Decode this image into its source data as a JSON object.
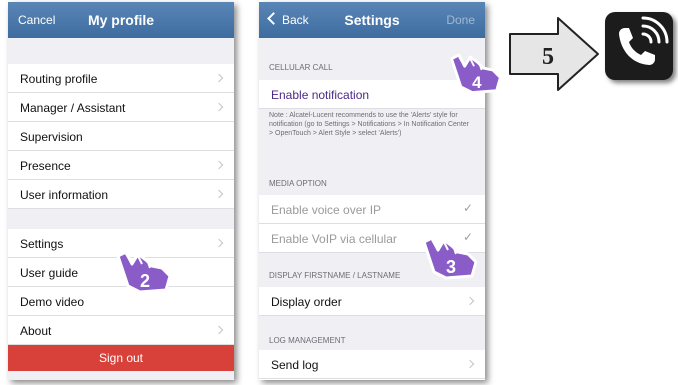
{
  "profile_screen": {
    "nav": {
      "cancel": "Cancel",
      "title": "My profile"
    },
    "items_group1": [
      "Routing profile",
      "Manager / Assistant",
      "Supervision",
      "Presence",
      "User information"
    ],
    "items_group2": [
      "Settings",
      "User guide",
      "Demo video",
      "About"
    ],
    "sign_out": "Sign out"
  },
  "settings_screen": {
    "nav": {
      "back": "Back",
      "title": "Settings",
      "done": "Done"
    },
    "cellular_header": "CELLULAR CALL",
    "enable_notification": "Enable notification",
    "note": "Note : Alcatel-Lucent recommends to use the 'Alerts' style for notification (go to Settings > Notifications > In Notification Center > OpenTouch > Alert Style > select 'Alerts')",
    "media_header": "MEDIA OPTION",
    "voice_over_ip": "Enable voice over IP",
    "voip_cellular": "Enable VoIP via cellular",
    "display_header": "DISPLAY FIRSTNAME / LASTNAME",
    "display_order": "Display order",
    "log_header": "LOG MANAGEMENT",
    "send_log": "Send log",
    "check_glyph": "✓"
  },
  "annotations": {
    "step2": "2",
    "step3": "3",
    "step4": "4",
    "step5": "5"
  },
  "colors": {
    "navbar": "#4a77a9",
    "signout": "#d8413a",
    "badge": "#8a5cc8"
  }
}
